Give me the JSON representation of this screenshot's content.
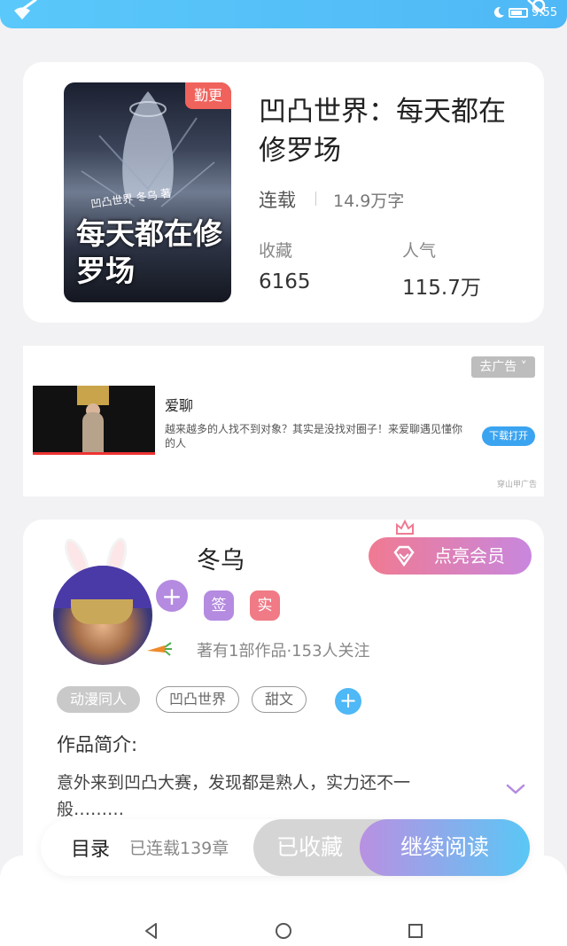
{
  "status_bar": {
    "time": "9:55"
  },
  "book": {
    "badge": "勤更",
    "cover_subtitle": "凹凸世界 冬乌 著",
    "cover_title": "每天都在修罗场",
    "title": "凹凸世界：每天都在修罗场",
    "status": "连载",
    "word_count": "14.9万字",
    "favorites_label": "收藏",
    "favorites_value": "6165",
    "popularity_label": "人气",
    "popularity_value": "115.7万"
  },
  "ad": {
    "remove_label": "去广告 ˅",
    "app_name": "爱聊",
    "description": "越来越多的人找不到对象？其实是没找对圈子！来爱聊遇见懂你的人",
    "download_label": "下载打开",
    "source": "穿山甲广告"
  },
  "author": {
    "name": "冬乌",
    "vip_label": "点亮会员",
    "tag_sign": "签",
    "tag_real": "实",
    "meta": "著有1部作品·153人关注",
    "genres": [
      "动漫同人",
      "凹凸世界",
      "甜文"
    ],
    "intro_label": "作品简介:",
    "intro_text": "意外来到凹凸大赛，发现都是熟人，实力还不一般………"
  },
  "action_bar": {
    "catalog_label": "目录",
    "chapters_text": "已连载139章",
    "saved_label": "已收藏",
    "read_label": "继续阅读"
  },
  "colors": {
    "accent_blue": "#4fb8f6",
    "accent_purple": "#b48be0",
    "accent_pink": "#f07a86",
    "badge_red": "#f0625c"
  },
  "icons": [
    "wifi-icon",
    "moon-icon",
    "battery-icon",
    "plus-icon",
    "diamond-icon",
    "crown-icon",
    "chevron-down-icon",
    "back-nav-icon",
    "home-nav-icon",
    "recents-nav-icon"
  ]
}
